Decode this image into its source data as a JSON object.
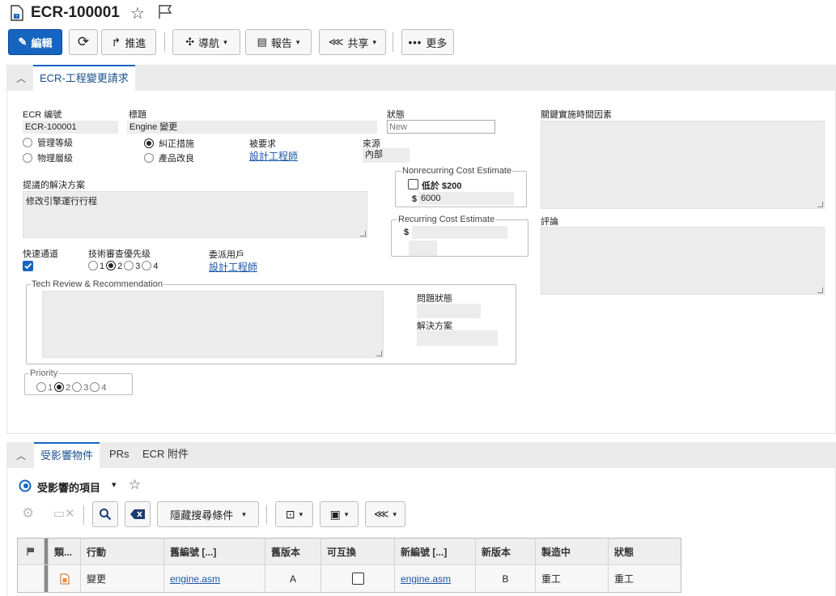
{
  "header": {
    "title": "ECR-100001"
  },
  "toolbar": {
    "edit": "編輯",
    "promote": "推進",
    "navigate": "導航",
    "reports": "報告",
    "share": "共享",
    "more": "更多"
  },
  "form_panel": {
    "tab": "ECR-工程變更請求",
    "ecr_number": {
      "label": "ECR 编號",
      "value": "ECR-100001"
    },
    "title": {
      "label": "標題",
      "value": "Engine 變更"
    },
    "status": {
      "label": "狀態",
      "placeholder": "New"
    },
    "key_factors": {
      "label": "關鍵實施時間因素",
      "value": ""
    },
    "level": {
      "options": [
        "管理等級",
        "物理層級"
      ]
    },
    "category": {
      "options": [
        "糾正措施",
        "產品改良"
      ],
      "selected": "糾正措施"
    },
    "requested_by": {
      "label": "被要求",
      "value": "設計工程師"
    },
    "source": {
      "label": "來源",
      "value": "內部"
    },
    "proposed_solution": {
      "label": "提議的解決方案",
      "value": "修改引擎運行行程"
    },
    "nonrecurring": {
      "legend": "Nonrecurring Cost Estimate",
      "under_200": "低於 $200",
      "currency": "$",
      "amount": "6000"
    },
    "recurring": {
      "legend": "Recurring Cost Estimate",
      "currency": "$"
    },
    "comments": {
      "label": "評論"
    },
    "fast_track": {
      "label": "快速通道",
      "checked": true
    },
    "tech_review_priority": {
      "label": "技術審查優先级",
      "options": [
        "1",
        "2",
        "3",
        "4"
      ],
      "selected": "2"
    },
    "assigned_user": {
      "label": "委派用戶",
      "value": "設計工程師"
    },
    "tech_review": {
      "legend": "Tech Review & Recommendation",
      "issue_status_label": "問題狀態",
      "resolution_label": "解決方案"
    },
    "priority": {
      "legend": "Priority",
      "options": [
        "1",
        "2",
        "3",
        "4"
      ],
      "selected": "2"
    }
  },
  "affected_panel": {
    "tabs": [
      "受影響物件",
      "PRs",
      "ECR 附件"
    ],
    "list_title": "受影響的項目",
    "hide_search": "隱藏搜尋條件",
    "columns": [
      "類...",
      "行動",
      "舊編號 [...]",
      "舊版本",
      "可互換",
      "新編號 [...]",
      "新版本",
      "製造中",
      "狀態"
    ],
    "rows": [
      {
        "action": "變更",
        "old_number": "engine.asm",
        "old_rev": "A",
        "interchangeable": false,
        "new_number": "engine.asm",
        "new_rev": "B",
        "manufacturing": "重工",
        "status": "重工"
      }
    ]
  },
  "colors": {
    "accent": "#1565c0",
    "link": "#1a56a8",
    "field_bg": "#ececec"
  }
}
